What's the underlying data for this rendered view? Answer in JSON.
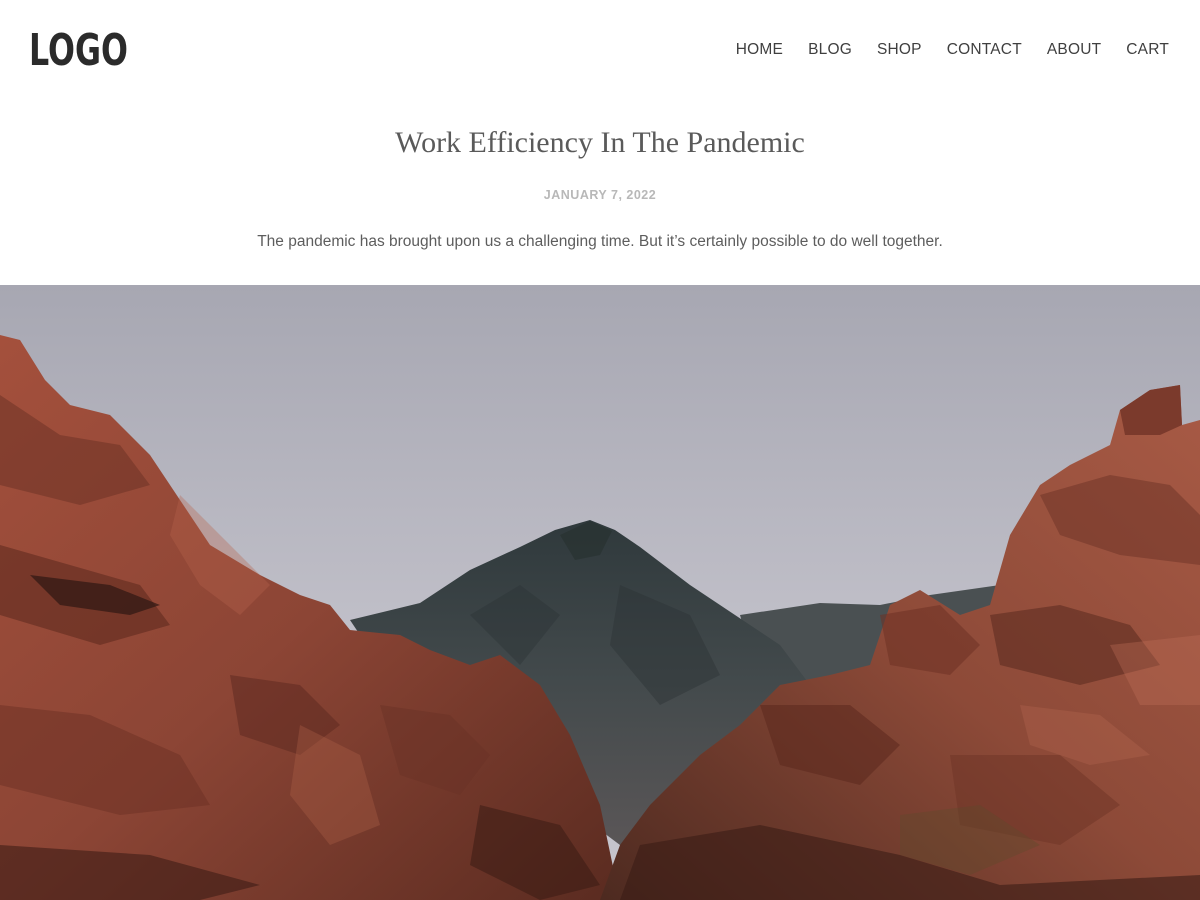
{
  "header": {
    "logo": "LOGO",
    "nav": [
      {
        "label": "HOME"
      },
      {
        "label": "BLOG"
      },
      {
        "label": "SHOP"
      },
      {
        "label": "CONTACT"
      },
      {
        "label": "ABOUT"
      },
      {
        "label": "CART"
      }
    ]
  },
  "post": {
    "title": "Work Efficiency In The Pandemic",
    "date": "JANUARY 7, 2022",
    "excerpt": "The pandemic has brought upon us a challenging time. But it’s certainly possible to do well together."
  },
  "colors": {
    "sky": "#b7b5bf",
    "mountain": "#3b4244",
    "rock": "#9a4d3a",
    "rock_shadow": "#3a1e17",
    "text": "#3a3a3a",
    "muted": "#b8b8b8"
  }
}
